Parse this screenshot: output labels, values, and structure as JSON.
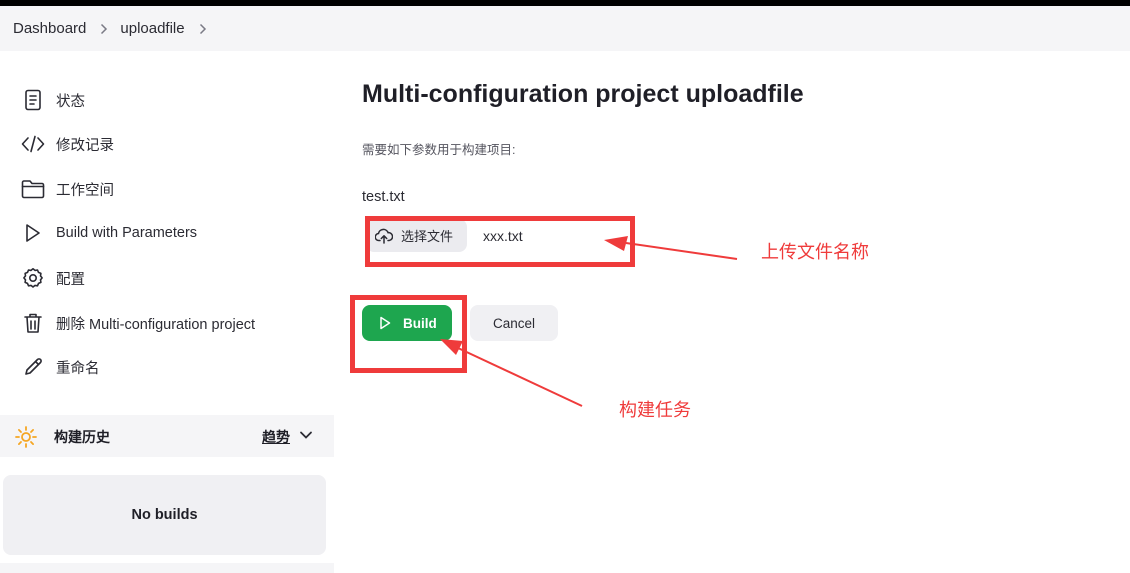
{
  "breadcrumb": {
    "items": [
      "Dashboard",
      "uploadfile"
    ]
  },
  "sidebar": {
    "items": [
      {
        "label": "状态",
        "icon": "document-icon"
      },
      {
        "label": "修改记录",
        "icon": "code-icon"
      },
      {
        "label": "工作空间",
        "icon": "folder-icon"
      },
      {
        "label": "Build with Parameters",
        "icon": "play-icon"
      },
      {
        "label": "配置",
        "icon": "gear-icon"
      },
      {
        "label": "删除 Multi-configuration project",
        "icon": "trash-icon"
      },
      {
        "label": "重命名",
        "icon": "pencil-icon"
      }
    ]
  },
  "build_history": {
    "title": "构建历史",
    "trend": "趋势",
    "empty": "No builds"
  },
  "main": {
    "title": "Multi-configuration project uploadfile",
    "description": "需要如下参数用于构建项目:",
    "param_name": "test.txt",
    "choose_file_label": "选择文件",
    "file_name": "xxx.txt",
    "build_label": "Build",
    "cancel_label": "Cancel"
  },
  "annotations": {
    "upload_label": "上传文件名称",
    "build_label": "构建任务"
  },
  "colors": {
    "accent_green": "#1ea64f",
    "annotation_red": "#ef3b3b"
  }
}
